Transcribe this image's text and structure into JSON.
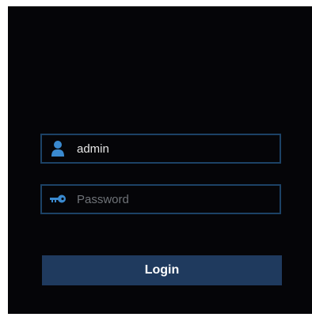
{
  "login": {
    "username": {
      "value": "admin",
      "icon": "user-icon"
    },
    "password": {
      "placeholder": "Password",
      "icon": "key-icon"
    },
    "button_label": "Login"
  },
  "colors": {
    "background": "#050508",
    "field_border": "#1c4266",
    "icon_accent": "#3a8ad0",
    "button_bg": "#1f3a5e",
    "button_text": "#ffffff",
    "placeholder_text": "#6f7378"
  }
}
